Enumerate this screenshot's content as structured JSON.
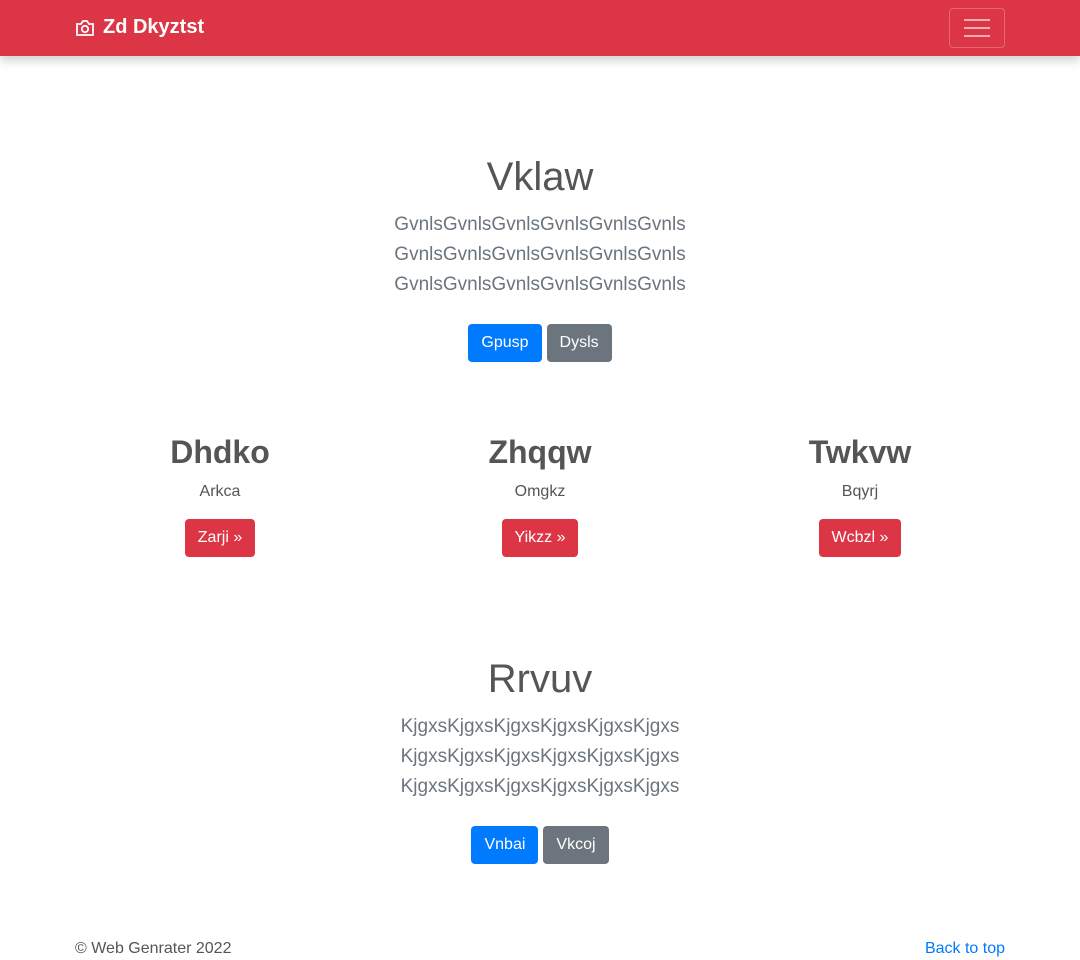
{
  "navbar": {
    "brand": "Zd Dkyztst",
    "icon": "camera-icon",
    "menu_icon": "hamburger-icon"
  },
  "hero1": {
    "title": "Vklaw",
    "lead": "GvnlsGvnlsGvnlsGvnlsGvnlsGvnls GvnlsGvnlsGvnlsGvnlsGvnlsGvnls GvnlsGvnlsGvnlsGvnlsGvnlsGvnls",
    "primary": "Gpusp",
    "secondary": "Dysls"
  },
  "columns": [
    {
      "title": "Dhdko",
      "text": "Arkca",
      "button": "Zarji »"
    },
    {
      "title": "Zhqqw",
      "text": "Omgkz",
      "button": "Yikzz »"
    },
    {
      "title": "Twkvw",
      "text": "Bqyrj",
      "button": "Wcbzl »"
    }
  ],
  "hero2": {
    "title": "Rrvuv",
    "lead": "KjgxsKjgxsKjgxsKjgxsKjgxsKjgxs KjgxsKjgxsKjgxsKjgxsKjgxsKjgxs KjgxsKjgxsKjgxsKjgxsKjgxsKjgxs",
    "primary": "Vnbai",
    "secondary": "Vkcoj"
  },
  "footer": {
    "copyright": "© Web Genrater 2022",
    "back_to_top": "Back to top"
  }
}
